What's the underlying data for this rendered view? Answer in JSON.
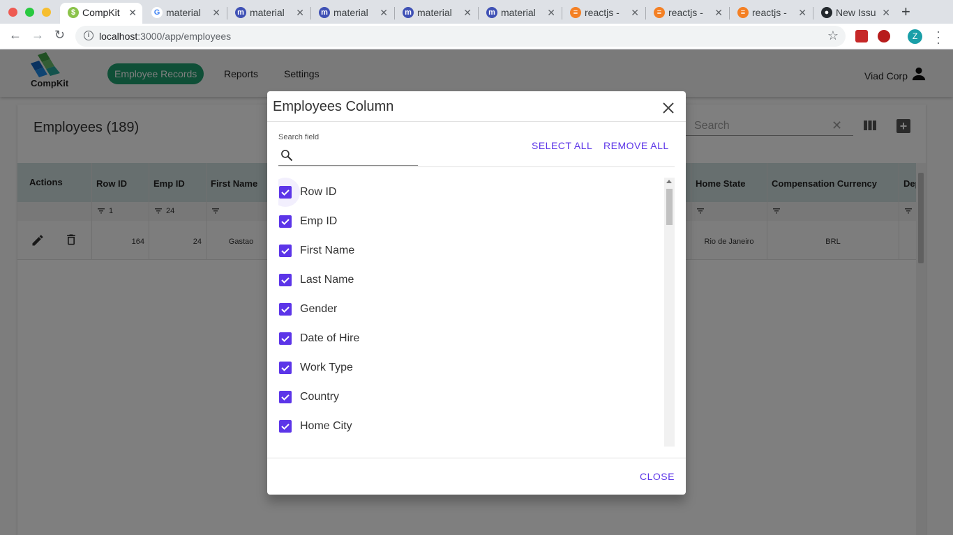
{
  "browser": {
    "tabs": [
      {
        "title": "CompKit",
        "active": true
      },
      {
        "title": "material",
        "active": false
      },
      {
        "title": "material",
        "active": false
      },
      {
        "title": "material",
        "active": false
      },
      {
        "title": "material",
        "active": false
      },
      {
        "title": "material",
        "active": false
      },
      {
        "title": "reactjs -",
        "active": false
      },
      {
        "title": "reactjs -",
        "active": false
      },
      {
        "title": "reactjs -",
        "active": false
      },
      {
        "title": "New Issu",
        "active": false
      }
    ],
    "url_host": "localhost",
    "url_path": ":3000/app/employees",
    "profile_initial": "Z"
  },
  "app": {
    "logo_text": "CompKit",
    "nav": {
      "employee_records": "Employee Records",
      "reports": "Reports",
      "settings": "Settings"
    },
    "user_name": "Viad Corp"
  },
  "table": {
    "title": "Employees (189)",
    "search_placeholder": "Search",
    "headers": {
      "actions": "Actions",
      "row_id": "Row ID",
      "emp_id": "Emp ID",
      "first_name": "First Name",
      "home_state": "Home State",
      "compensation_currency": "Compensation Currency",
      "dep": "Dep"
    },
    "filters": {
      "row_id": "1",
      "emp_id": "24"
    },
    "row": {
      "row_id": "164",
      "emp_id": "24",
      "first_name": "Gastao",
      "home_state": "Rio de Janeiro",
      "compensation_currency": "BRL"
    }
  },
  "dialog": {
    "title": "Employees Column",
    "search_label": "Search field",
    "select_all": "SELECT ALL",
    "remove_all": "REMOVE ALL",
    "close": "CLOSE",
    "columns": [
      {
        "label": "Row ID",
        "checked": true
      },
      {
        "label": "Emp ID",
        "checked": true
      },
      {
        "label": "First Name",
        "checked": true
      },
      {
        "label": "Last Name",
        "checked": true
      },
      {
        "label": "Gender",
        "checked": true
      },
      {
        "label": "Date of Hire",
        "checked": true
      },
      {
        "label": "Work Type",
        "checked": true
      },
      {
        "label": "Country",
        "checked": true
      },
      {
        "label": "Home City",
        "checked": true
      }
    ]
  },
  "colors": {
    "accent": "#5c35e8",
    "nav_active": "#1f9e6e",
    "table_header": "#cfdede"
  }
}
